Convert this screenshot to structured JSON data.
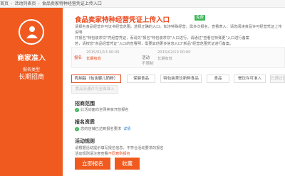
{
  "breadcrumb": [
    "首页",
    "活动列表页",
    "食品卖家特种经营凭证上传入口"
  ],
  "sidebar": {
    "title": "商家准入",
    "small": "报名类型",
    "big": "长期招商"
  },
  "header": {
    "title": "食品卖家特种经营凭证上传入口",
    "badge": "免费",
    "desc_1": "请报名食品经营许可证书经营范围。选择正确的入口。如涉特殊经营，需多次报名。查看表入：请您阅读食品许可经营凭证上传说明",
    "desc_2": "并报名\"特包装茶饮\"凭经营凭证，而请先\"报名\"特包装茶饮\"入口进行。请通过\"查看在特殊更\"入口进行备案",
    "desc_3": "若，请按您\"食品经营凭证\"入口的查看明，需要其他更多信息入口\"新品\"经营范围凭证进行备案。"
  },
  "timebar": {
    "signup_label": "报名",
    "signup_time": "2015/02/13 00:00",
    "signup_sub": "长期有效",
    "activity_label": "活动",
    "activity_status": "不限制",
    "activity_time": "2015/02/13 00:00",
    "activity_sub": "长期有效"
  },
  "tabs": [
    {
      "label": "乳制品（包含婴儿奶粉）"
    },
    {
      "label": "保健食品"
    },
    {
      "label": "特包装茶饮新鲜食品"
    },
    {
      "label": "食品"
    },
    {
      "label": "餐饮许可准入"
    },
    {
      "label": "已通过审"
    }
  ],
  "tab_row2": "食品流通许可全面准入",
  "sections": {
    "scope_title": "招商范围",
    "scope_text": "此活动面向全网卖家开放报名",
    "qual_title": "报名资质",
    "qual_text": "您的店铺已达到报名要求",
    "qual_link": "详情",
    "rules_title": "活动规则",
    "rules_text_1": "请根据活动提示填写报名信息，不符合活动要求的报名",
    "rules_text_2": "活动规则请注意查看",
    "rules_link": "不同意则报名"
  },
  "buttons": {
    "signup": "立即报名",
    "favorite": "收藏"
  },
  "colors": {
    "accent": "#f05a1f",
    "title": "#e8491d",
    "success": "#3fb85a",
    "link": "#2a7fd4"
  }
}
